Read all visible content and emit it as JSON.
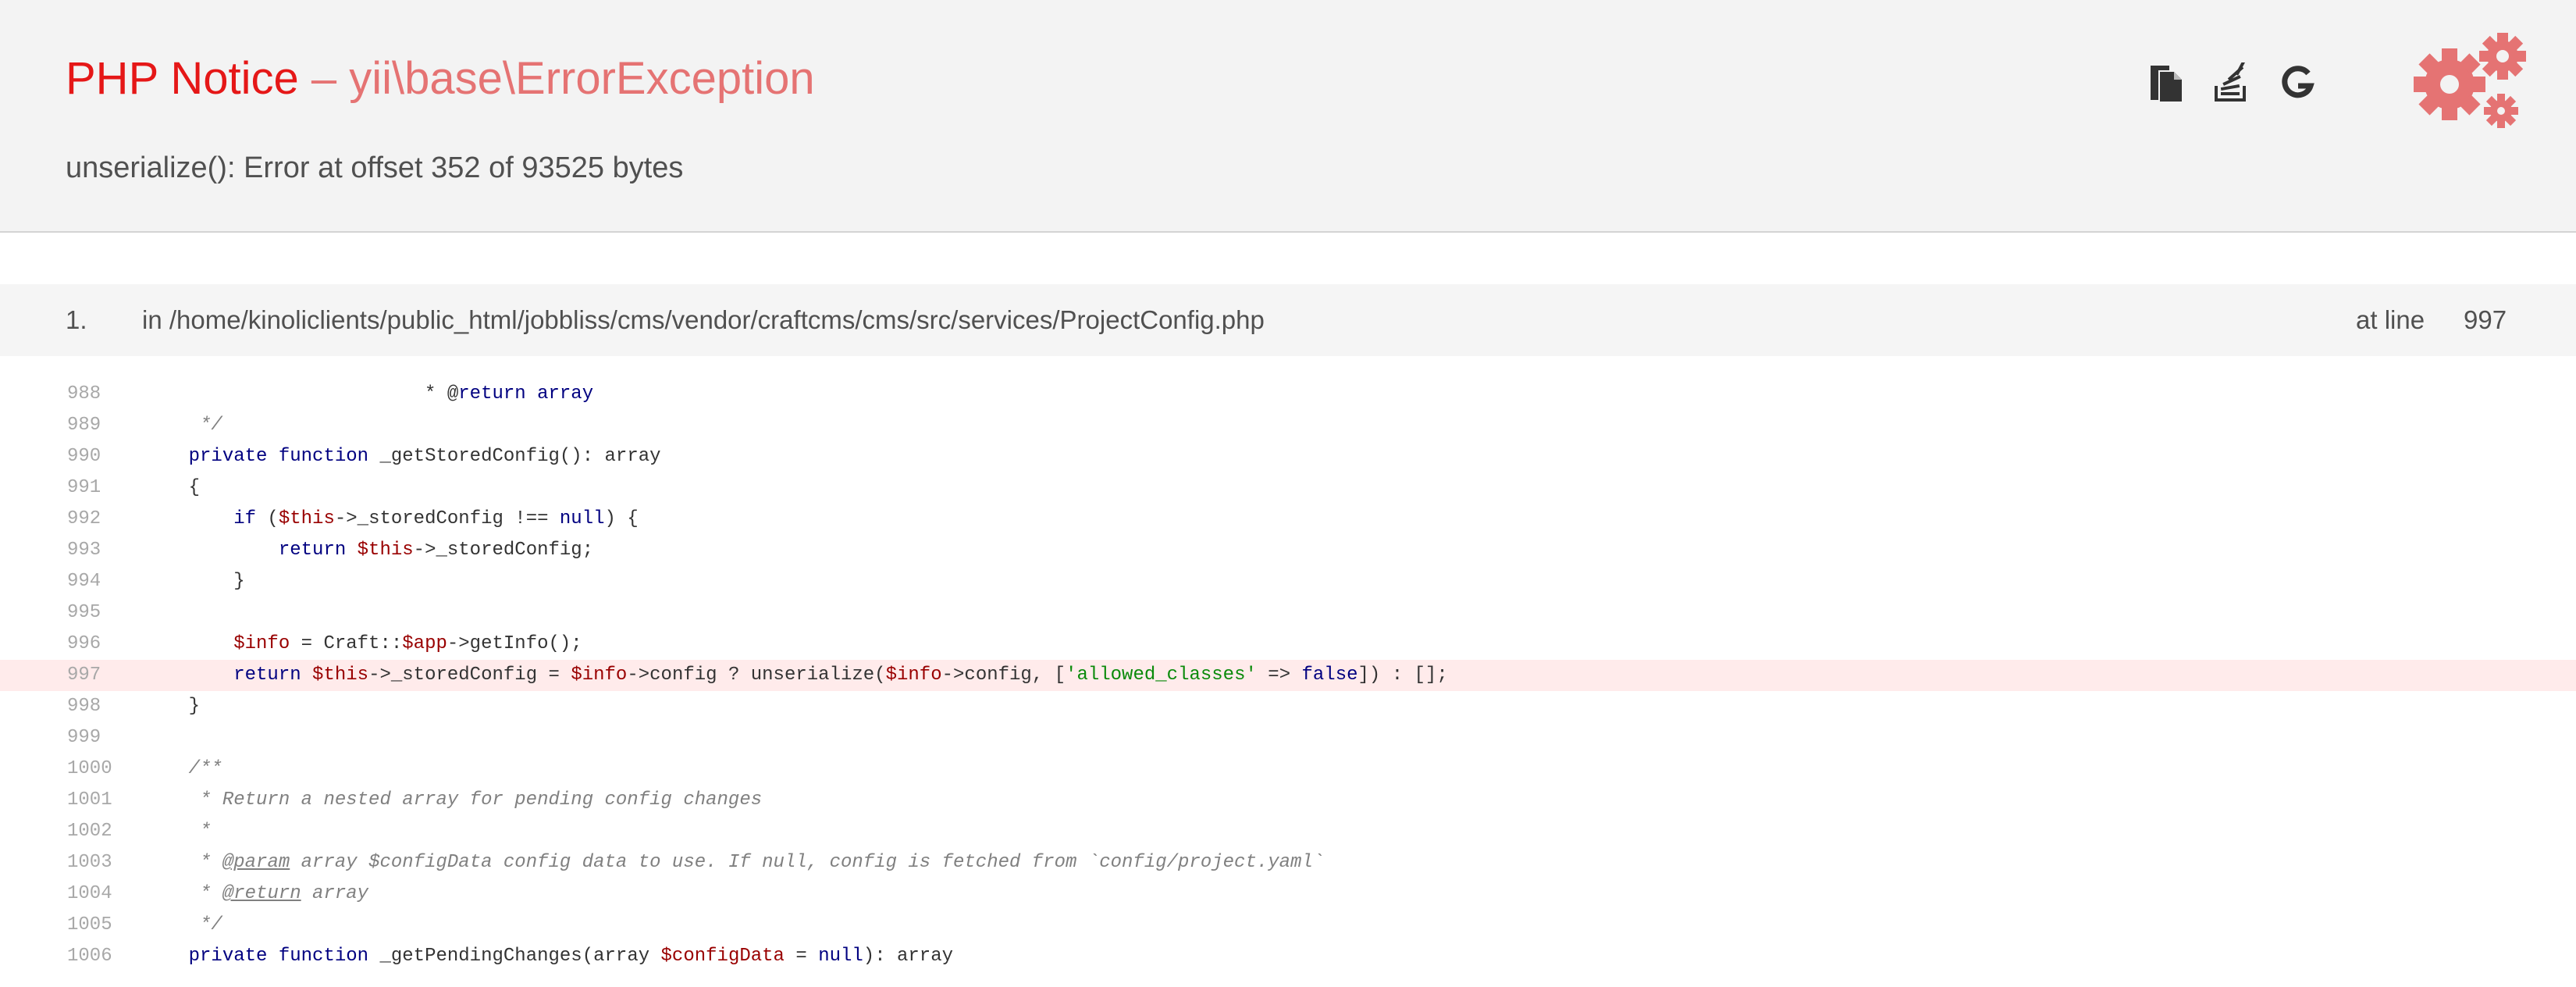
{
  "header": {
    "error_type": "PHP Notice",
    "separator": "–",
    "exception_class": "yii\\base\\ErrorException",
    "message": "unserialize(): Error at offset 352 of 93525 bytes",
    "tools": [
      "copy-icon",
      "stackoverflow-icon",
      "google-icon"
    ],
    "logo": "gears-icon"
  },
  "call_stack": {
    "number": "1.",
    "file": "in /home/kinoliclients/public_html/jobbliss/cms/vendor/craftcms/cms/src/services/ProjectConfig.php",
    "at_line_label": "at line",
    "line": "997"
  },
  "code": {
    "error_line": "997",
    "lines": [
      {
        "n": "988",
        "text": "                         * @return array"
      },
      {
        "n": "989",
        "text": "     */"
      },
      {
        "n": "990",
        "text": "    private function _getStoredConfig(): array"
      },
      {
        "n": "991",
        "text": "    {"
      },
      {
        "n": "992",
        "text": "        if ($this->_storedConfig !== null) {"
      },
      {
        "n": "993",
        "text": "            return $this->_storedConfig;"
      },
      {
        "n": "994",
        "text": "        }"
      },
      {
        "n": "995",
        "text": ""
      },
      {
        "n": "996",
        "text": "        $info = Craft::$app->getInfo();"
      },
      {
        "n": "997",
        "text": "        return $this->_storedConfig = $info->config ? unserialize($info->config, ['allowed_classes' => false]) : [];"
      },
      {
        "n": "998",
        "text": "    }"
      },
      {
        "n": "999",
        "text": ""
      },
      {
        "n": "1000",
        "text": "    /**"
      },
      {
        "n": "1001",
        "text": "     * Return a nested array for pending config changes"
      },
      {
        "n": "1002",
        "text": "     *"
      },
      {
        "n": "1003",
        "text": "     * @param array $configData config data to use. If null, config is fetched from `config/project.yaml`"
      },
      {
        "n": "1004",
        "text": "     * @return array"
      },
      {
        "n": "1005",
        "text": "     */"
      },
      {
        "n": "1006",
        "text": "    private function _getPendingChanges(array $configData = null): array"
      }
    ]
  },
  "colors": {
    "error_red": "#e51717",
    "exception_pink": "#e57373",
    "header_bg": "#f3f3f3",
    "error_line_bg": "#ffebeb",
    "keyword": "#000080",
    "variable": "#990000",
    "string": "#0a8a0a"
  }
}
